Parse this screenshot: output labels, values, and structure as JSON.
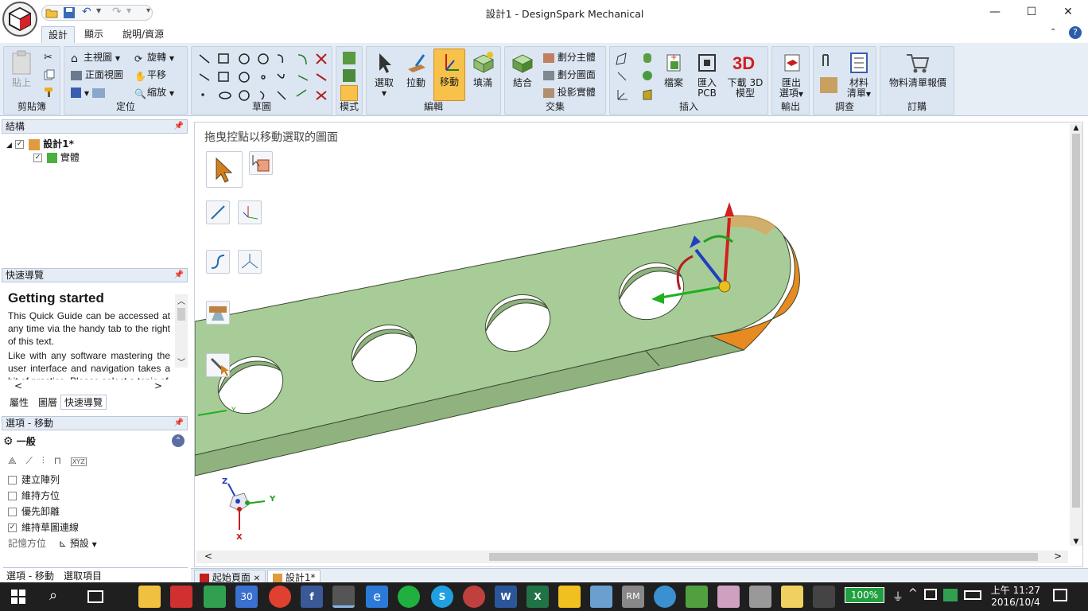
{
  "titlebar": {
    "title": "設計1 - DesignSpark Mechanical",
    "minimize": "—",
    "maximize": "☐",
    "close": "✕"
  },
  "tabs": [
    {
      "label": "設計"
    },
    {
      "label": "顯示"
    },
    {
      "label": "說明/資源"
    }
  ],
  "ribbon": {
    "clipboard": {
      "label": "剪貼簿",
      "paste": "貼上"
    },
    "orient": {
      "label": "定位",
      "home": "主視圖",
      "front": "正面視圖",
      "rotate": "旋轉",
      "pan": "平移",
      "zoom": "縮放"
    },
    "sketch": {
      "label": "草圖"
    },
    "mode": {
      "label": "模式"
    },
    "edit": {
      "label": "編輯",
      "select": "選取",
      "pull": "拉動",
      "move": "移動",
      "fill": "填滿"
    },
    "intersect": {
      "label": "交集",
      "combine": "結合",
      "split_body": "劃分主體",
      "split_face": "劃分圖面",
      "project": "投影實體"
    },
    "insert": {
      "label": "插入",
      "file": "檔案",
      "import_pcb_1": "匯入",
      "import_pcb_2": "PCB",
      "download_3d_1": "下載 3D",
      "download_3d_2": "模型"
    },
    "output": {
      "label": "輸出",
      "export_1": "匯出",
      "export_2": "選項"
    },
    "investigate": {
      "label": "調查",
      "bom_1": "材料",
      "bom_2": "清單"
    },
    "order": {
      "label": "訂購",
      "bom_quote": "物料清單報價"
    }
  },
  "structure": {
    "title": "結構",
    "root": "設計1*",
    "child": "實體"
  },
  "quickguide": {
    "title": "快速導覽",
    "heading": "Getting started",
    "para1": "This Quick Guide can be accessed at any time via the handy tab to the right of this text.",
    "para2": "Like with any software mastering the user interface and navigation takes a bit of practice. Please select a topic of",
    "tabs": [
      "屬性",
      "圖層",
      "快速導覽"
    ]
  },
  "options": {
    "title": "選項 - 移動",
    "section": "一般",
    "items": [
      {
        "label": "建立陣列",
        "checked": false
      },
      {
        "label": "維持方位",
        "checked": false
      },
      {
        "label": "優先卸離",
        "checked": false
      },
      {
        "label": "維持草圖連線",
        "checked": true
      }
    ],
    "memory_label": "記憶方位",
    "memory_value": "預設",
    "bottom_tabs": [
      "選項 - 移動",
      "選取項目"
    ]
  },
  "viewport": {
    "hint": "拖曳控點以移動選取的圖面",
    "axis": {
      "z": "Z",
      "y": "Y",
      "x": "X",
      "y_small": "Y"
    }
  },
  "doc_tabs": [
    "起始頁面",
    "設計1*"
  ],
  "taskbar": {
    "battery": "100%",
    "time": "上午 11:27",
    "date": "2016/10/4",
    "calendar_day": "30"
  },
  "colors": {
    "part_face": "#a8cc98",
    "part_side": "#8fb27f",
    "accent": "#cfe0f2",
    "move_highlight": "#f7c14a",
    "edge_orange": "#e88a22"
  }
}
